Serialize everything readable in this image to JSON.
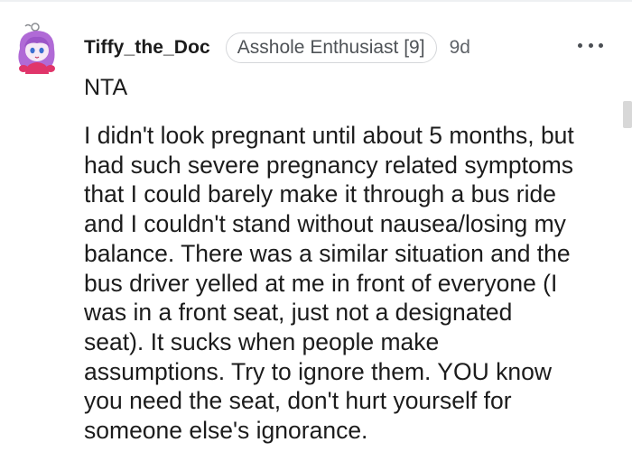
{
  "comment": {
    "username": "Tiffy_the_Doc",
    "flair": "Asshole Enthusiast [9]",
    "age": "9d",
    "verdict": "NTA",
    "body_lines": [
      "I didn't look pregnant until about 5 months, but",
      "had such severe pregnancy related symptoms",
      "that I could barely make it through a bus ride",
      "and I couldn't stand without nausea/losing my",
      "balance. There was a similar situation and the",
      "bus driver yelled at me in front of everyone (I",
      "was in a front seat, just not a designated",
      "seat). It sucks when people make",
      "assumptions. Try to ignore them. YOU know",
      "you need the seat, don't hurt yourself for",
      "someone else's ignorance."
    ]
  },
  "icons": {
    "avatar": "user-avatar-icon",
    "more": "more-options-icon"
  },
  "colors": {
    "avatar_hair": "#b06ad6",
    "avatar_shirt": "#e0356a",
    "text": "#1c1c1c",
    "meta": "#5f6368"
  }
}
